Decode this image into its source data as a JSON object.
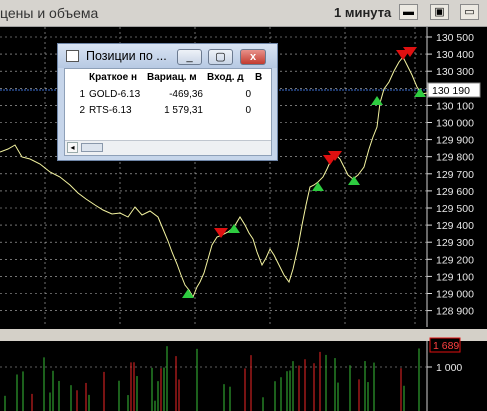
{
  "window": {
    "title": "цены и объема",
    "timeframe": "1 минута",
    "buttons": [
      "▭",
      "▫",
      "▭"
    ]
  },
  "dialog": {
    "title": "Позиции по ...",
    "columns": [
      "",
      "Краткое н",
      "Вариац. м",
      "Вход. д",
      "В"
    ],
    "rows": [
      {
        "n": "1",
        "name": "GOLD-6.13",
        "var": "-469,36",
        "inc": "0"
      },
      {
        "n": "2",
        "name": "RTS-6.13",
        "var": "1 579,31",
        "inc": "0"
      }
    ],
    "min_label": "_",
    "max_label": "▢",
    "close_label": "x"
  },
  "price_axis": {
    "ticks": [
      "130 500",
      "130 400",
      "130 300",
      "130 200",
      "130 100",
      "130 000",
      "129 900",
      "129 800",
      "129 700",
      "129 600",
      "129 500",
      "129 400",
      "129 300",
      "129 200",
      "129 100",
      "129 000",
      "128 900"
    ],
    "current_price": "130 190"
  },
  "volume_axis": {
    "max_label": "1 689",
    "tick_label": "1 000"
  },
  "colors": {
    "price_line": "#f4f4a0",
    "buy_marker": "#2ecc40",
    "sell_marker": "#e01010",
    "current_line": "#3b6fd6",
    "volume_up": "#2ea02e",
    "volume_down": "#c82020"
  }
}
